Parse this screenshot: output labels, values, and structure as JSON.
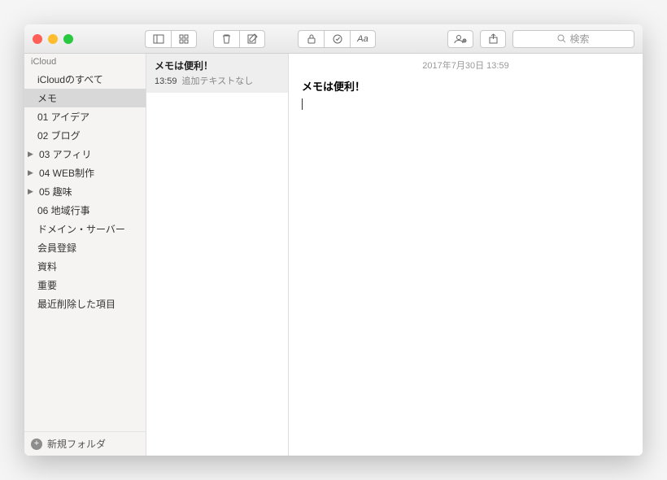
{
  "toolbar": {
    "search_placeholder": "検索"
  },
  "sidebar": {
    "section": "iCloud",
    "folders": [
      {
        "label": "iCloudのすべて",
        "expandable": false,
        "selected": false
      },
      {
        "label": "メモ",
        "expandable": false,
        "selected": true
      },
      {
        "label": "01 アイデア",
        "expandable": false,
        "selected": false
      },
      {
        "label": "02 ブログ",
        "expandable": false,
        "selected": false
      },
      {
        "label": "03 アフィリ",
        "expandable": true,
        "selected": false
      },
      {
        "label": "04 WEB制作",
        "expandable": true,
        "selected": false
      },
      {
        "label": "05 趣味",
        "expandable": true,
        "selected": false
      },
      {
        "label": "06 地域行事",
        "expandable": false,
        "selected": false
      },
      {
        "label": "ドメイン・サーバー",
        "expandable": false,
        "selected": false
      },
      {
        "label": "会員登録",
        "expandable": false,
        "selected": false
      },
      {
        "label": "資料",
        "expandable": false,
        "selected": false
      },
      {
        "label": "重要",
        "expandable": false,
        "selected": false
      },
      {
        "label": "最近削除した項目",
        "expandable": false,
        "selected": false
      }
    ],
    "new_folder": "新規フォルダ"
  },
  "notelist": {
    "items": [
      {
        "title": "メモは便利！",
        "time": "13:59",
        "snippet": "追加テキストなし",
        "selected": true
      }
    ]
  },
  "editor": {
    "date": "2017年7月30日 13:59",
    "title": "メモは便利！"
  }
}
